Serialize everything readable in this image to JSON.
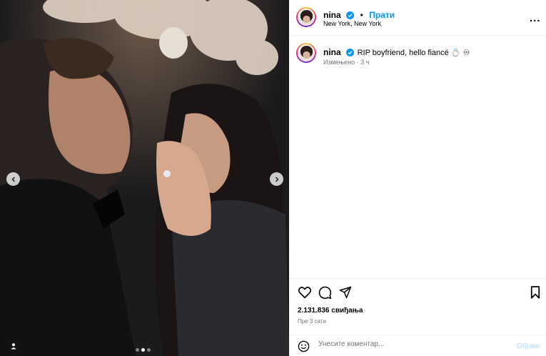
{
  "post": {
    "username": "nina",
    "follow_label": "Прати",
    "separator": "•",
    "location": "New York, New York",
    "more_label": "...",
    "caption": "RIP boyfriend, hello fiancé 💍 ♾",
    "caption_meta": "Измењено · 3 ч",
    "likes": "2.131.836 свиђања",
    "time_ago": "Пре 3 сати",
    "carousel": {
      "count": 3,
      "active_index": 1
    }
  },
  "comment": {
    "placeholder": "Унесите коментар...",
    "post_label": "Објави"
  },
  "colors": {
    "link_blue": "#0095f6",
    "post_disabled": "#b3dbff",
    "meta_gray": "#737373"
  },
  "icons": [
    "chevron-left-icon",
    "chevron-right-icon",
    "user-tag-icon",
    "verified-icon",
    "heart-icon",
    "comment-icon",
    "share-icon",
    "bookmark-icon",
    "emoji-icon"
  ]
}
